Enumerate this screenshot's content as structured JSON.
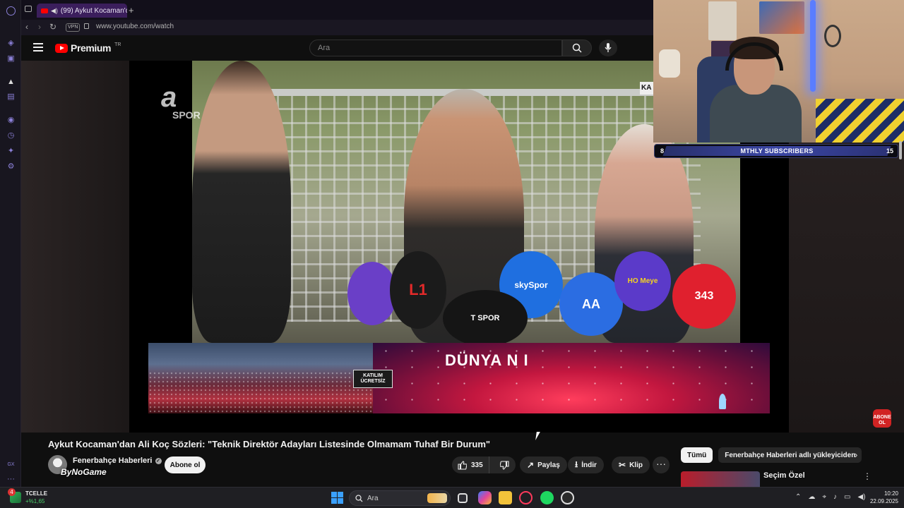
{
  "browser": {
    "tab_title": "(99) Aykut Kocaman'd",
    "vpn_label": "VPN",
    "url": "www.youtube.com/watch"
  },
  "youtube": {
    "logo_text": "Premium",
    "logo_region": "TR",
    "search_placeholder": "Ara"
  },
  "video": {
    "watermark_a": "a",
    "watermark_spor": "SPOR",
    "corner_text": "KA",
    "banner_title": "DÜNYA N I",
    "banner_badge_line1": "KATILIM",
    "banner_badge_line2": "ÜCRETSİZ",
    "abone_label_1": "ABONE",
    "abone_label_2": "OL",
    "mic_labels": [
      "L1",
      "skySpor",
      "AA",
      "HO Meye",
      "343",
      "T SPOR"
    ]
  },
  "stream_overlay": {
    "label": "MTHLY SUBSCRIBERS",
    "current": "8",
    "goal": "15",
    "progress": 0.5333
  },
  "watch": {
    "title": "Aykut Kocaman'dan Ali Koç Sözleri: \"Teknik Direktör Adayları Listesinde Olmamam Tuhaf Bir Durum\"",
    "channel_name": "Fenerbahçe Haberleri",
    "overlay_text": "ByNoGame",
    "subscribe_label": "Abone ol",
    "like_count": "335",
    "share_label": "Paylaş",
    "download_label": "İndir",
    "clip_label": "Klip",
    "more_label": "···"
  },
  "recommendations": {
    "chips": [
      "Tümü",
      "Fenerbahçe Haberleri adlı yükleyiciden"
    ],
    "first_title": "Seçim Özel",
    "menu_label": "⋮"
  },
  "taskbar": {
    "weather_badge": "4",
    "weather_label": "TCELLE",
    "weather_change": "+%1,65",
    "search_placeholder": "Ara",
    "time": "10:20",
    "date": "22.09.2025"
  },
  "colors": {
    "accent_red": "#ff0000",
    "opera_purple": "#8a7fd6",
    "subscriber_bar": "#3b46a5"
  }
}
